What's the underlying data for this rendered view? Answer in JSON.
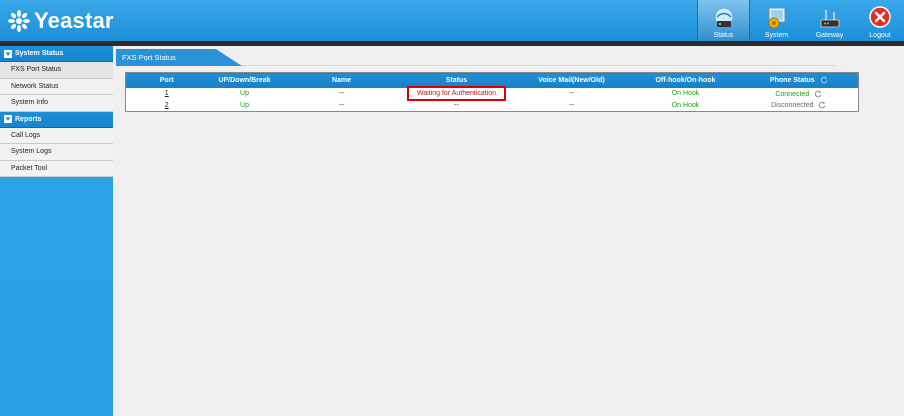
{
  "header": {
    "logo_text": "Yeastar",
    "nav": [
      {
        "label": "Status",
        "icon": "status-icon"
      },
      {
        "label": "System",
        "icon": "system-icon"
      },
      {
        "label": "Gateway",
        "icon": "gateway-icon"
      },
      {
        "label": "Logout",
        "icon": "logout-icon"
      }
    ]
  },
  "sidebar": {
    "sections": [
      {
        "title": "System Status",
        "items": [
          "FXS Port Status",
          "Network Status",
          "System Info"
        ]
      },
      {
        "title": "Reports",
        "items": [
          "Call Logs",
          "System Logs",
          "Packet Tool"
        ]
      }
    ]
  },
  "content": {
    "tab_title": "FXS Port Status",
    "table": {
      "headers": [
        "Port",
        "UP/Down/Break",
        "Name",
        "Status",
        "Voice Mail(New/Old)",
        "Off-hook/On-hook",
        "Phone Status"
      ],
      "rows": [
        {
          "port": "1",
          "updown": "Up",
          "name": "--",
          "status": "Waiting for Authentication",
          "voicemail": "--",
          "hook": "On Hook",
          "phone_status": "Connected"
        },
        {
          "port": "2",
          "updown": "Up",
          "name": "--",
          "status": "--",
          "voicemail": "--",
          "hook": "On Hook",
          "phone_status": "Disconnected"
        }
      ]
    }
  },
  "colors": {
    "header_blue": "#1b8fd8",
    "sidebar_blue": "#2ea4e6",
    "ok_green": "#1aa01a",
    "alert_red": "#cc1111"
  }
}
